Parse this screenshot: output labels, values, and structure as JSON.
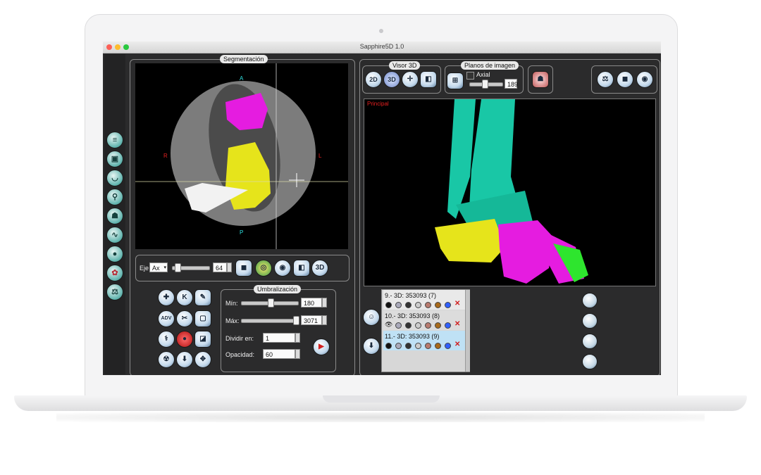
{
  "window": {
    "title": "Sapphire5D 1.0"
  },
  "segmentation": {
    "legend": "Segmentación",
    "view": {
      "label_top": "A",
      "label_bottom": "P",
      "label_left": "R",
      "label_right": "L"
    },
    "axis": {
      "label": "Eje",
      "value": "Ax",
      "slice": "64"
    },
    "buttons": {
      "view_3d": "3D"
    }
  },
  "threshold": {
    "legend": "Umbralización",
    "min_label": "Mín:",
    "min_value": "180",
    "max_label": "Máx:",
    "max_value": "3071",
    "divide_label": "Dividir en:",
    "divide_value": "1",
    "opacity_label": "Opacidad:",
    "opacity_value": "60"
  },
  "tools": {
    "adv_label": "ADV",
    "k_label": "K"
  },
  "viewer3d": {
    "legend": "Visor 3D",
    "btn_2d": "2D",
    "btn_3d": "3D",
    "viewport_label": "Principal"
  },
  "planes": {
    "legend": "Planos de imagen",
    "axial_label": "Axial",
    "slice_value": "189"
  },
  "layers": [
    {
      "label": "9.- 3D: 353093 (7)"
    },
    {
      "label": "10.- 3D: 353093 (8)"
    },
    {
      "label": "11.- 3D: 353093 (9)"
    }
  ],
  "colors": {
    "bone": "#19c7a6",
    "pink": "#e51ce0",
    "yellow": "#e6e41b",
    "green": "#2ee52e",
    "accent_red": "#d02020"
  }
}
